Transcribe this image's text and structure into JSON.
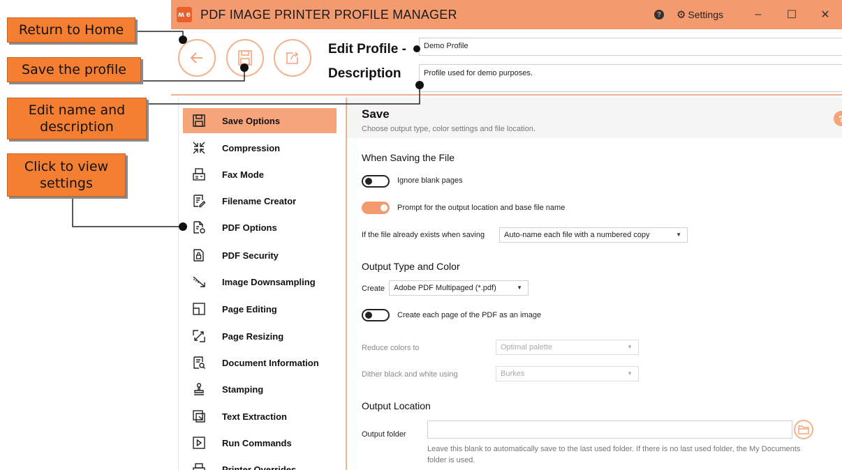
{
  "app": {
    "title": "PDF IMAGE PRINTER PROFILE MANAGER",
    "logo_text": "ʍ e",
    "settings_label": "Settings",
    "help_glyph": "?",
    "window_buttons": {
      "minimize": "–",
      "maximize": "☐",
      "close": "✕"
    }
  },
  "toolbar": {
    "edit_profile_label": "Edit Profile -",
    "description_label": "Description",
    "profile_name": "Demo Profile",
    "profile_description": "Profile used for demo purposes.",
    "buttons": {
      "back_icon": "arrow-left-icon",
      "save_icon": "floppy-disk-icon",
      "export_icon": "share-export-icon"
    }
  },
  "sidebar": {
    "items": [
      {
        "label": "Save Options",
        "icon": "save-options-icon",
        "active": true
      },
      {
        "label": "Compression",
        "icon": "compression-icon"
      },
      {
        "label": "Fax Mode",
        "icon": "fax-icon"
      },
      {
        "label": "Filename Creator",
        "icon": "filename-creator-icon"
      },
      {
        "label": "PDF Options",
        "icon": "pdf-options-icon"
      },
      {
        "label": "PDF Security",
        "icon": "pdf-security-icon"
      },
      {
        "label": "Image Downsampling",
        "icon": "image-downsampling-icon"
      },
      {
        "label": "Page Editing",
        "icon": "page-editing-icon"
      },
      {
        "label": "Page Resizing",
        "icon": "page-resizing-icon"
      },
      {
        "label": "Document Information",
        "icon": "document-information-icon"
      },
      {
        "label": "Stamping",
        "icon": "stamping-icon"
      },
      {
        "label": "Text Extraction",
        "icon": "text-extraction-icon"
      },
      {
        "label": "Run Commands",
        "icon": "run-commands-icon"
      },
      {
        "label": "Printer Overrides",
        "icon": "printer-overrides-icon"
      }
    ]
  },
  "main": {
    "title": "Save",
    "subtitle": "Choose output type, color settings and file location.",
    "help_glyph": "?",
    "when_saving": {
      "heading": "When Saving the File",
      "ignore_blank": {
        "label": "Ignore blank pages",
        "on": false
      },
      "prompt_output": {
        "label": "Prompt for the output location and base file name",
        "on": true
      },
      "file_exists_label": "If the file already exists when saving",
      "file_exists_value": "Auto-name each file with a numbered copy"
    },
    "output_type": {
      "heading": "Output Type and Color",
      "create_label": "Create",
      "create_value": "Adobe PDF Multipaged (*.pdf)",
      "page_as_image": {
        "label": "Create each page of the PDF as an image",
        "on": false
      },
      "reduce_colors_label": "Reduce colors to",
      "reduce_colors_value": "Optimal palette",
      "dither_label": "Dither black and white using",
      "dither_value": "Burkes"
    },
    "output_location": {
      "heading": "Output Location",
      "folder_label": "Output folder",
      "folder_value": "",
      "hint": "Leave this blank to automatically save to the last used folder. If there is no last used folder, the My Documents folder is used."
    }
  },
  "callouts": {
    "return_home": "Return to Home",
    "save_profile": "Save the profile",
    "edit_name": "Edit name and description",
    "view_settings": "Click to view settings"
  },
  "colors": {
    "accent": "#f39a6f",
    "accent_light": "#f6a57b",
    "callout": "#f47f33"
  }
}
